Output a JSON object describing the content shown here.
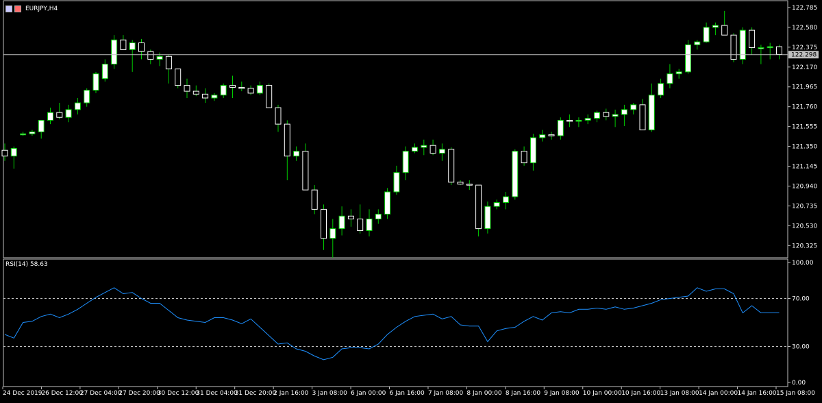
{
  "symbol_label": "EURJPY,H4",
  "current_price": "122.298",
  "rsi_label": "RSI(14) 58.63",
  "colors": {
    "background": "#000000",
    "bull_body": "#ffffff",
    "bear_body": "#000000",
    "wick": "#00cc00",
    "rsi_line": "#1e90ff",
    "grid": "#c0c0c0"
  },
  "chart_data": [
    {
      "type": "candlestick",
      "title": "EURJPY,H4",
      "ylim": [
        120.2,
        122.82
      ],
      "yticks": [
        "122.785",
        "122.580",
        "122.375",
        "122.170",
        "121.965",
        "121.760",
        "121.555",
        "121.350",
        "121.145",
        "120.940",
        "120.735",
        "120.530",
        "120.325"
      ],
      "xticks": [
        "24 Dec 2019",
        "26 Dec 12:00",
        "27 Dec 04:00",
        "27 Dec 20:00",
        "30 Dec 12:00",
        "31 Dec 04:00",
        "31 Dec 20:00",
        "2 Jan 16:00",
        "3 Jan 08:00",
        "6 Jan 00:00",
        "6 Jan 16:00",
        "7 Jan 08:00",
        "8 Jan 00:00",
        "8 Jan 16:00",
        "9 Jan 08:00",
        "10 Jan 00:00",
        "10 Jan 16:00",
        "13 Jan 08:00",
        "14 Jan 00:00",
        "14 Jan 16:00",
        "15 Jan 08:00"
      ],
      "current_price": 122.298,
      "ohlc": [
        [
          121.31,
          121.38,
          121.2,
          121.25
        ],
        [
          121.25,
          121.35,
          121.12,
          121.33
        ],
        [
          121.48,
          121.5,
          121.46,
          121.48
        ],
        [
          121.48,
          121.52,
          121.46,
          121.5
        ],
        [
          121.5,
          121.58,
          121.43,
          121.62
        ],
        [
          121.62,
          121.75,
          121.58,
          121.7
        ],
        [
          121.7,
          121.8,
          121.63,
          121.65
        ],
        [
          121.65,
          121.78,
          121.6,
          121.73
        ],
        [
          121.73,
          121.85,
          121.68,
          121.8
        ],
        [
          121.8,
          121.95,
          121.76,
          121.93
        ],
        [
          121.93,
          122.12,
          121.9,
          122.1
        ],
        [
          122.05,
          122.25,
          122.02,
          122.2
        ],
        [
          122.2,
          122.5,
          122.15,
          122.45
        ],
        [
          122.45,
          122.5,
          122.35,
          122.35
        ],
        [
          122.35,
          122.45,
          122.12,
          122.42
        ],
        [
          122.42,
          122.46,
          122.25,
          122.33
        ],
        [
          122.33,
          122.35,
          122.2,
          122.25
        ],
        [
          122.25,
          122.32,
          122.18,
          122.28
        ],
        [
          122.28,
          122.3,
          122.0,
          122.15
        ],
        [
          122.15,
          122.15,
          121.95,
          121.98
        ],
        [
          121.98,
          122.05,
          121.85,
          121.92
        ],
        [
          121.92,
          121.98,
          121.87,
          121.89
        ],
        [
          121.89,
          121.95,
          121.8,
          121.85
        ],
        [
          121.85,
          121.9,
          121.82,
          121.88
        ],
        [
          121.88,
          122.0,
          121.85,
          121.98
        ],
        [
          121.98,
          122.08,
          121.85,
          121.96
        ],
        [
          121.96,
          122.02,
          121.92,
          121.95
        ],
        [
          121.95,
          121.98,
          121.88,
          121.9
        ],
        [
          121.9,
          122.02,
          121.88,
          121.98
        ],
        [
          121.98,
          122.0,
          121.75,
          121.75
        ],
        [
          121.75,
          121.78,
          121.5,
          121.58
        ],
        [
          121.58,
          121.62,
          121.0,
          121.25
        ],
        [
          121.25,
          121.35,
          121.2,
          121.3
        ],
        [
          121.3,
          121.38,
          120.9,
          120.9
        ],
        [
          120.9,
          120.95,
          120.65,
          120.7
        ],
        [
          120.7,
          120.75,
          120.28,
          120.4
        ],
        [
          120.4,
          120.6,
          120.2,
          120.5
        ],
        [
          120.5,
          120.73,
          120.43,
          120.63
        ],
        [
          120.63,
          120.7,
          120.52,
          120.6
        ],
        [
          120.6,
          120.75,
          120.45,
          120.48
        ],
        [
          120.48,
          120.7,
          120.42,
          120.6
        ],
        [
          120.6,
          120.7,
          120.55,
          120.65
        ],
        [
          120.65,
          120.92,
          120.6,
          120.88
        ],
        [
          120.88,
          121.15,
          120.85,
          121.08
        ],
        [
          121.08,
          121.35,
          121.0,
          121.3
        ],
        [
          121.3,
          121.38,
          121.28,
          121.34
        ],
        [
          121.34,
          121.42,
          121.26,
          121.36
        ],
        [
          121.36,
          121.42,
          121.26,
          121.28
        ],
        [
          121.28,
          121.38,
          121.2,
          121.32
        ],
        [
          121.32,
          121.34,
          120.95,
          120.98
        ],
        [
          120.98,
          121.0,
          120.95,
          120.96
        ],
        [
          120.96,
          121.0,
          120.9,
          120.95
        ],
        [
          120.95,
          120.95,
          120.42,
          120.5
        ],
        [
          120.5,
          120.78,
          120.45,
          120.73
        ],
        [
          120.73,
          120.8,
          120.7,
          120.77
        ],
        [
          120.77,
          120.88,
          120.7,
          120.83
        ],
        [
          120.83,
          121.32,
          120.8,
          121.3
        ],
        [
          121.3,
          121.35,
          121.15,
          121.18
        ],
        [
          121.18,
          121.48,
          121.1,
          121.44
        ],
        [
          121.44,
          121.52,
          121.4,
          121.47
        ],
        [
          121.47,
          121.5,
          121.42,
          121.46
        ],
        [
          121.46,
          121.65,
          121.42,
          121.62
        ],
        [
          121.62,
          121.68,
          121.55,
          121.61
        ],
        [
          121.61,
          121.65,
          121.55,
          121.62
        ],
        [
          121.62,
          121.68,
          121.58,
          121.64
        ],
        [
          121.64,
          121.72,
          121.6,
          121.7
        ],
        [
          121.7,
          121.74,
          121.62,
          121.66
        ],
        [
          121.66,
          121.73,
          121.55,
          121.68
        ],
        [
          121.68,
          121.78,
          121.56,
          121.73
        ],
        [
          121.73,
          121.8,
          121.68,
          121.78
        ],
        [
          121.78,
          121.84,
          121.6,
          121.52
        ],
        [
          121.52,
          122.0,
          121.5,
          121.88
        ],
        [
          121.88,
          122.05,
          121.85,
          122.0
        ],
        [
          122.0,
          122.2,
          121.95,
          122.1
        ],
        [
          122.1,
          122.15,
          122.05,
          122.12
        ],
        [
          122.12,
          122.45,
          122.1,
          122.4
        ],
        [
          122.4,
          122.45,
          122.35,
          122.43
        ],
        [
          122.43,
          122.63,
          122.42,
          122.58
        ],
        [
          122.58,
          122.63,
          122.5,
          122.6
        ],
        [
          122.6,
          122.75,
          122.5,
          122.5
        ],
        [
          122.5,
          122.52,
          122.22,
          122.25
        ],
        [
          122.25,
          122.58,
          122.2,
          122.55
        ],
        [
          122.55,
          122.58,
          122.3,
          122.37
        ],
        [
          122.37,
          122.4,
          122.2,
          122.37
        ],
        [
          122.37,
          122.42,
          122.25,
          122.38
        ],
        [
          122.38,
          122.4,
          122.25,
          122.3
        ]
      ]
    },
    {
      "type": "line",
      "title": "RSI(14) 58.63",
      "ylim": [
        0,
        100
      ],
      "yticks": [
        "100.00",
        "70.00",
        "30.00",
        "0.00"
      ],
      "levels": [
        70,
        30
      ],
      "values": [
        40,
        37,
        50,
        51,
        55,
        57,
        54,
        57,
        61,
        66,
        71,
        75,
        79,
        74,
        75,
        70,
        66,
        66,
        60,
        54,
        52,
        51,
        50,
        54,
        54,
        52,
        49,
        53,
        46,
        39,
        32,
        33,
        28,
        26,
        22,
        19,
        21,
        28,
        29,
        29,
        28,
        32,
        40,
        46,
        51,
        55,
        56,
        57,
        53,
        55,
        48,
        47,
        47,
        34,
        43,
        45,
        46,
        51,
        55,
        52,
        58,
        59,
        58,
        61,
        61,
        62,
        61,
        63,
        61,
        62,
        64,
        66,
        69,
        70,
        71,
        72,
        79,
        76,
        78,
        78,
        74,
        58,
        64,
        58,
        58,
        58
      ]
    }
  ]
}
